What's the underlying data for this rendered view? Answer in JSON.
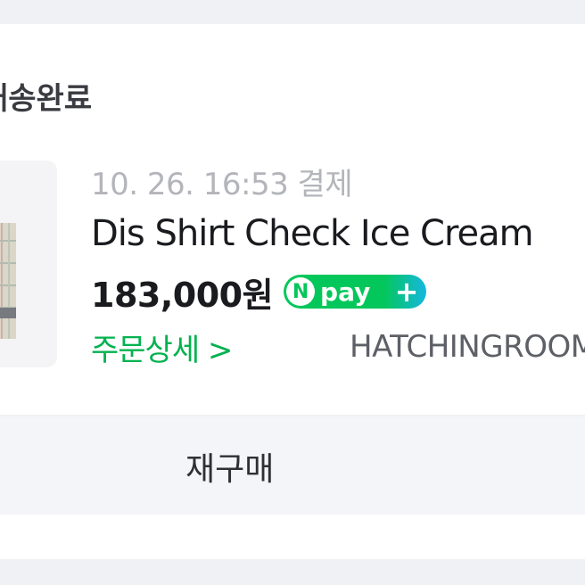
{
  "order": {
    "status": "배송완료",
    "date": "10. 26. 16:53 결제",
    "product_name": "Dis Shirt Check Ice Cream",
    "price": "183,000원",
    "payment_badge": {
      "n": "N",
      "pay": "pay",
      "plus": "+"
    },
    "detail_link": "주문상세 >",
    "seller": "HATCHINGROOM"
  },
  "rebuy": {
    "label": "재구매"
  },
  "colors": {
    "npay_green": "#03c75a",
    "link_green": "#03b24f",
    "text_dark": "#1a1b1f",
    "text_gray": "#b3b5ba"
  },
  "icons": [
    "product-thumbnail",
    "npay-plus-icon"
  ]
}
